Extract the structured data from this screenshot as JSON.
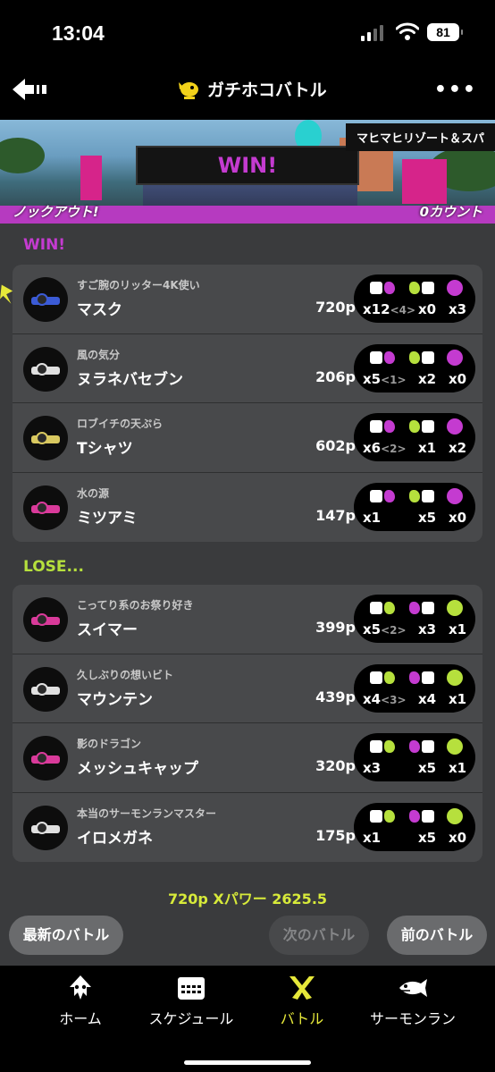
{
  "status": {
    "time": "13:04",
    "battery": "81"
  },
  "nav": {
    "title": "ガチホコバトル"
  },
  "banner": {
    "result": "WIN!",
    "stage": "マヒマヒリゾート＆スパ",
    "knockout": "ノックアウト!",
    "count": "0カウント"
  },
  "colors": {
    "win": "#c43bd0",
    "lose": "#b6e03d",
    "summary": "#d7ea3a",
    "active_tab": "#e6e83a"
  },
  "win_team": {
    "label": "WIN!",
    "players": [
      {
        "tag": "すご腕のリッター4K使い",
        "name": "マスク",
        "points": "720p",
        "kills": "x12",
        "assists": "<4>",
        "deaths": "x0",
        "specials": "x3",
        "weapon_color": "#3b5bd6",
        "special_color": "#c43bd0"
      },
      {
        "tag": "風の気分",
        "name": "ヌラネバセブン",
        "points": "206p",
        "kills": "x5",
        "assists": "<1>",
        "deaths": "x2",
        "specials": "x0",
        "weapon_color": "#e0e0e0",
        "special_color": "#c43bd0"
      },
      {
        "tag": "ロブイチの天ぷら",
        "name": "Tシャツ",
        "points": "602p",
        "kills": "x6",
        "assists": "<2>",
        "deaths": "x1",
        "specials": "x2",
        "weapon_color": "#d8c860",
        "special_color": "#c43bd0"
      },
      {
        "tag": "水の源",
        "name": "ミツアミ",
        "points": "147p",
        "kills": "x1",
        "assists": "",
        "deaths": "x5",
        "specials": "x0",
        "weapon_color": "#d93a9a",
        "special_color": "#c43bd0"
      }
    ]
  },
  "lose_team": {
    "label": "LOSE...",
    "players": [
      {
        "tag": "こってり系のお祭り好き",
        "name": "スイマー",
        "points": "399p",
        "kills": "x5",
        "assists": "<2>",
        "deaths": "x3",
        "specials": "x1",
        "weapon_color": "#d93a9a",
        "special_color": "#b6e03d"
      },
      {
        "tag": "久しぶりの想いビト",
        "name": "マウンテン",
        "points": "439p",
        "kills": "x4",
        "assists": "<3>",
        "deaths": "x4",
        "specials": "x1",
        "weapon_color": "#e0e0e0",
        "special_color": "#b6e03d"
      },
      {
        "tag": "影のドラゴン",
        "name": "メッシュキャップ",
        "points": "320p",
        "kills": "x3",
        "assists": "",
        "deaths": "x5",
        "specials": "x1",
        "weapon_color": "#d93a9a",
        "special_color": "#b6e03d"
      },
      {
        "tag": "本当のサーモンランマスター",
        "name": "イロメガネ",
        "points": "175p",
        "kills": "x1",
        "assists": "",
        "deaths": "x5",
        "specials": "x0",
        "weapon_color": "#e0e0e0",
        "special_color": "#b6e03d"
      }
    ]
  },
  "summary": "720p Xパワー 2625.5",
  "buttons": {
    "latest": "最新のバトル",
    "next": "次のバトル",
    "prev": "前のバトル"
  },
  "tabs": [
    {
      "label": "ホーム",
      "icon": "squid-icon"
    },
    {
      "label": "スケジュール",
      "icon": "calendar-icon"
    },
    {
      "label": "バトル",
      "icon": "battle-icon"
    },
    {
      "label": "サーモンラン",
      "icon": "salmon-icon"
    }
  ]
}
